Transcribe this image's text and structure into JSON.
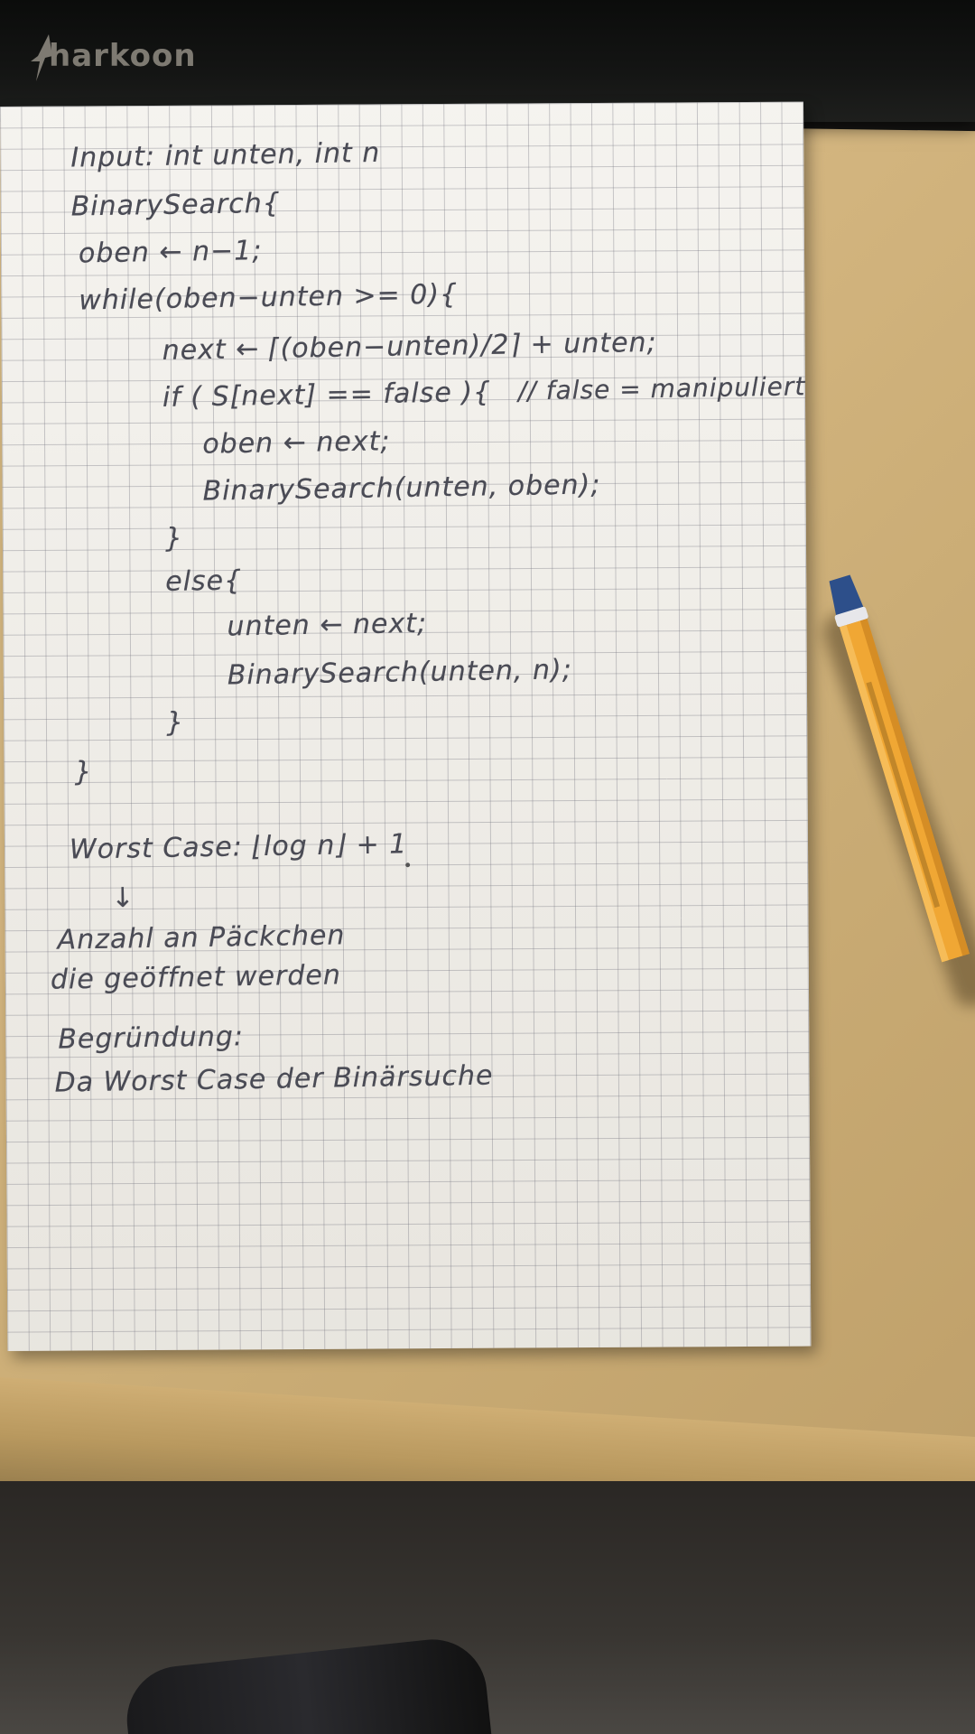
{
  "brand": {
    "logo_text": "harkoon"
  },
  "notes": {
    "line1": "Input: int unten, int n",
    "line2": "BinarySearch{",
    "line3": "oben ← n−1;",
    "line4": "while(oben−unten >= 0){",
    "line5": "next ← ⌈(oben−unten)/2⌉ + unten;",
    "line6": "if ( S[next] == false ){",
    "line6_comment": "// false = manipuliert",
    "line7": "oben ← next;",
    "line8": "BinarySearch(unten, oben);",
    "line9": "}",
    "line10": "else{",
    "line11": "unten ← next;",
    "line12": "BinarySearch(unten, n);",
    "line13": "}",
    "line14": "}",
    "worst_case": "Worst Case: ⌊log n⌋ + 1",
    "arrow": "↓",
    "count_line1": "Anzahl an Päckchen",
    "count_line2": "die geöffnet werden",
    "reason_label": "Begründung:",
    "reason_text": "Da Worst Case der Binärsuche"
  },
  "colors": {
    "ink": "#4a4b55",
    "paper": "#f3f1ec",
    "desk": "#d3b57f",
    "pen_body": "#f0a734",
    "pen_cap": "#2d4f8a"
  }
}
